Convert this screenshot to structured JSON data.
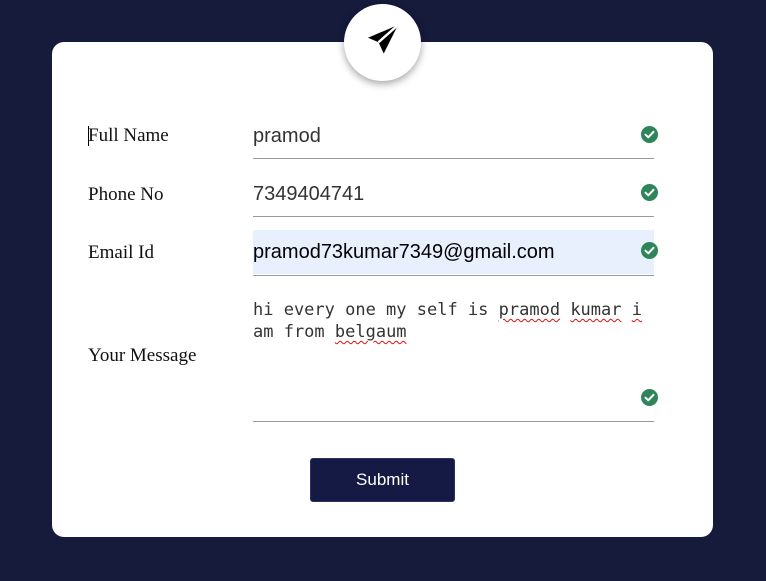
{
  "form": {
    "badge_icon": "paper-plane-icon",
    "fields": [
      {
        "label": "Full Name",
        "value": "pramod"
      },
      {
        "label": "Phone No",
        "value": "7349404741"
      },
      {
        "label": "Email Id",
        "value": "pramod73kumar7349@gmail.com"
      }
    ],
    "message": {
      "label": "Your Message",
      "part1": "hi every one my self is ",
      "word_pramod": "pramod",
      "space1": " ",
      "word_kumar": "kumar",
      "space2": " ",
      "word_i": "i",
      "part2": "\nam from ",
      "word_belgaum": "belgaum"
    },
    "valid_icon": "check-circle-icon",
    "submit_label": "Submit"
  },
  "colors": {
    "background": "#161a3b",
    "card": "#ffffff",
    "valid": "#2e8559",
    "button": "#151a45",
    "autofill": "#e8f0fe"
  }
}
